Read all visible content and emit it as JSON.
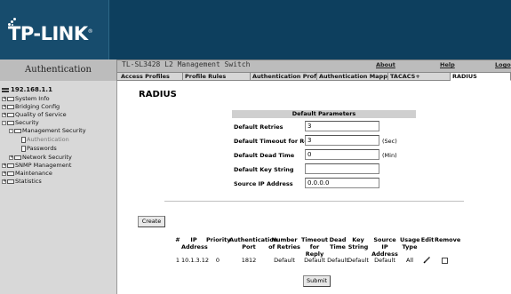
{
  "brand": {
    "logo_text": "TP-LINK",
    "logo_mark": "®"
  },
  "header": {
    "section_title": "Authentication",
    "switch_title": "TL-SL3428 L2 Management Switch",
    "links": {
      "about": "About",
      "help": "Help",
      "logout": "Logo"
    }
  },
  "tabs": [
    {
      "label": "Access Profiles",
      "active": false
    },
    {
      "label": "Profile Rules",
      "active": false
    },
    {
      "label": "Authentication Profiles",
      "active": false
    },
    {
      "label": "Authentication Mapping",
      "active": false
    },
    {
      "label": "TACACS+",
      "active": false
    },
    {
      "label": "RADIUS",
      "active": true
    }
  ],
  "sidebar": {
    "root": "192.168.1.1",
    "items": [
      {
        "label": "System Info",
        "expander": "+"
      },
      {
        "label": "Bridging Config",
        "expander": "+"
      },
      {
        "label": "Quality of Service",
        "expander": "+"
      },
      {
        "label": "Security",
        "expander": "-"
      },
      {
        "label": "Management Security",
        "expander": "-"
      },
      {
        "label": "Authentication"
      },
      {
        "label": "Passwords"
      },
      {
        "label": "Network Security",
        "expander": "+"
      },
      {
        "label": "SNMP Management",
        "expander": "+"
      },
      {
        "label": "Maintenance",
        "expander": "+"
      },
      {
        "label": "Statistics",
        "expander": "+"
      }
    ]
  },
  "main": {
    "title": "RADIUS",
    "default_params": {
      "header": "Default Parameters",
      "rows": [
        {
          "label": "Default Retries",
          "value": "3",
          "unit": ""
        },
        {
          "label": "Default Timeout for Reply",
          "value": "3",
          "unit": "(Sec)"
        },
        {
          "label": "Default Dead Time",
          "value": "0",
          "unit": "(Min)"
        },
        {
          "label": "Default Key String",
          "value": "",
          "unit": ""
        },
        {
          "label": "Source IP Address",
          "value": "0.0.0.0",
          "unit": ""
        }
      ]
    },
    "create_label": "Create",
    "table": {
      "columns": [
        "#",
        "IP Address",
        "Priority",
        "Authentication Port",
        "Number of Retries",
        "Timeout for Reply",
        "Dead Time",
        "Key String",
        "Source IP Address",
        "Usage Type",
        "Edit",
        "Remove"
      ],
      "rows": [
        {
          "num": "1",
          "ip": "10.1.3.12",
          "priority": "0",
          "auth_port": "1812",
          "retries": "Default",
          "timeout": "Default",
          "dead_time": "Default",
          "key": "Default",
          "source_ip": "Default",
          "usage": "All"
        }
      ]
    },
    "submit_label": "Submit"
  }
}
